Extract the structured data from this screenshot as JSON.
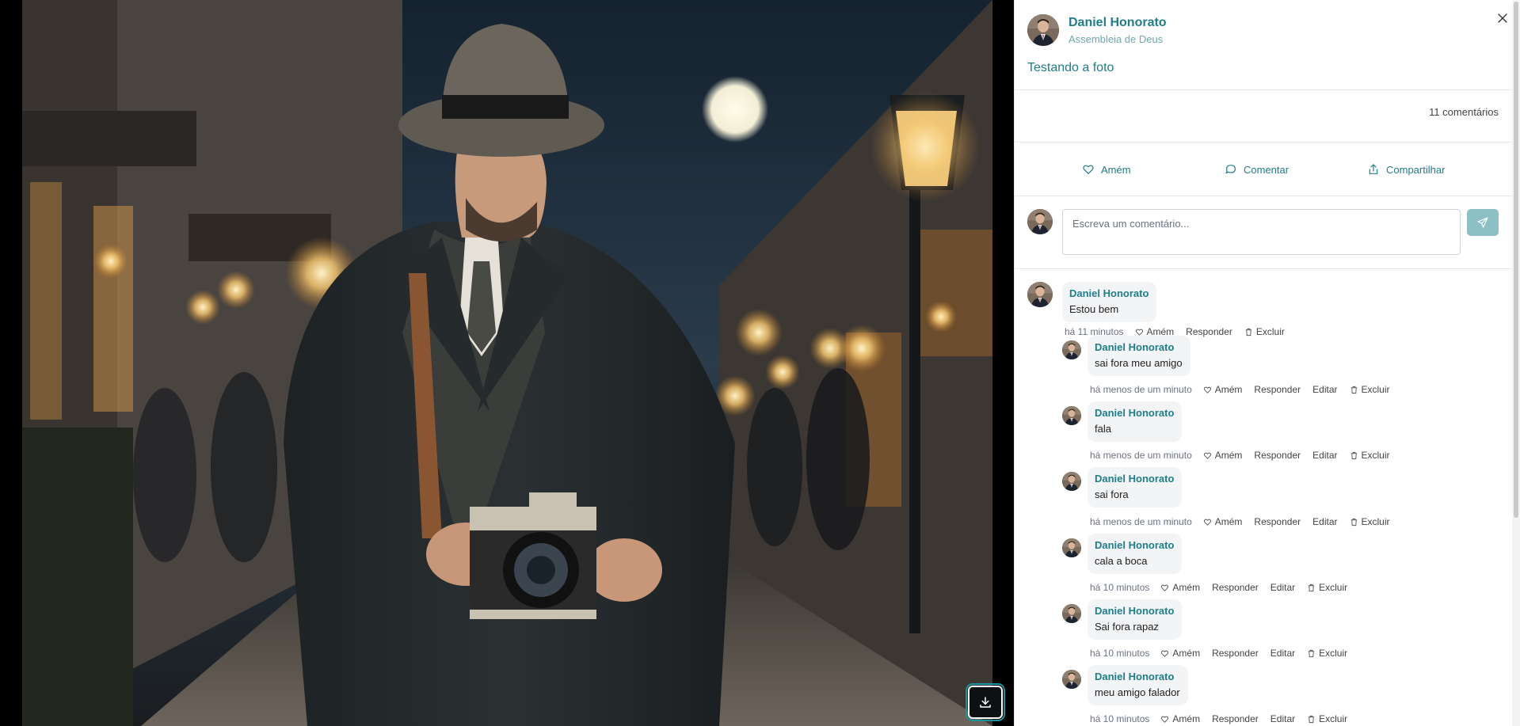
{
  "post": {
    "author": "Daniel Honorato",
    "church": "Assembleia de Deus",
    "text": "Testando a foto",
    "comment_count": "11 comentários"
  },
  "actions": {
    "amen": "Amém",
    "comment": "Comentar",
    "share": "Compartilhar"
  },
  "composer": {
    "placeholder": "Escreva um comentário..."
  },
  "comment_actions": {
    "amen": "Amém",
    "reply": "Responder",
    "edit": "Editar",
    "delete": "Excluir"
  },
  "comments": [
    {
      "author": "Daniel Honorato",
      "text": "Estou bem",
      "time": "há 11 minutos"
    },
    {
      "author": "Daniel Honorato",
      "text": "sai fora meu amigo",
      "time": "há menos de um minuto"
    },
    {
      "author": "Daniel Honorato",
      "text": "fala",
      "time": "há menos de um minuto"
    },
    {
      "author": "Daniel Honorato",
      "text": "sai fora",
      "time": "há menos de um minuto"
    },
    {
      "author": "Daniel Honorato",
      "text": "cala a boca",
      "time": "há 10 minutos"
    },
    {
      "author": "Daniel Honorato",
      "text": "Sai fora rapaz",
      "time": "há 10 minutos"
    },
    {
      "author": "Daniel Honorato",
      "text": "meu amigo falador",
      "time": "há 10 minutos"
    }
  ],
  "colors": {
    "accent": "#1f7e88",
    "send_button": "#8cc0c5",
    "bubble": "#f3f4f6"
  },
  "icons": [
    "download-icon",
    "close-icon",
    "heart-icon",
    "chat-icon",
    "share-icon",
    "send-icon",
    "trash-icon"
  ]
}
